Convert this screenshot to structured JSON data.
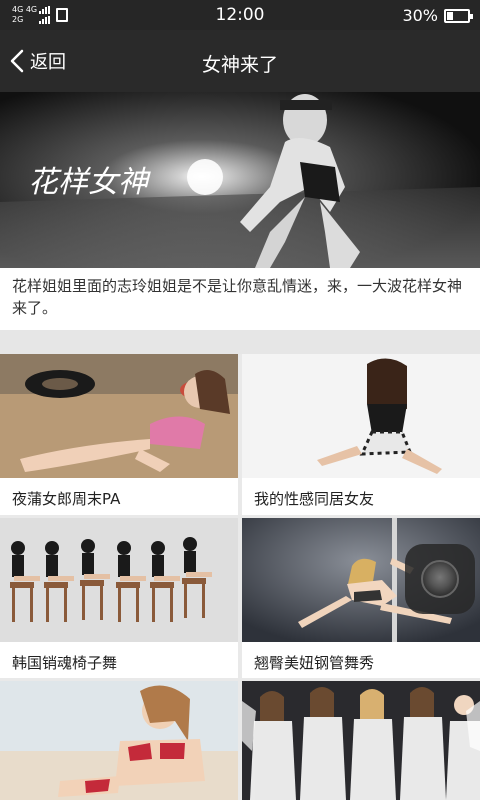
{
  "status_bar": {
    "network_top": "4G 4G",
    "network_bottom": "2G",
    "time": "12:00",
    "battery_percent": "30%",
    "battery_level": 0.3
  },
  "nav": {
    "back_label": "返回",
    "title": "女神来了"
  },
  "hero": {
    "overlay_text": "花样女神",
    "caption": "花样姐姐里面的志玲姐姐是不是让你意乱情迷，来，一大波花样女神来了。"
  },
  "cards": [
    {
      "label": "夜蒲女郎周末PA"
    },
    {
      "label": "我的性感同居女友"
    },
    {
      "label": "韩国销魂椅子舞"
    },
    {
      "label": "翘臀美妞钢管舞秀"
    },
    {
      "label": ""
    },
    {
      "label": ""
    }
  ]
}
